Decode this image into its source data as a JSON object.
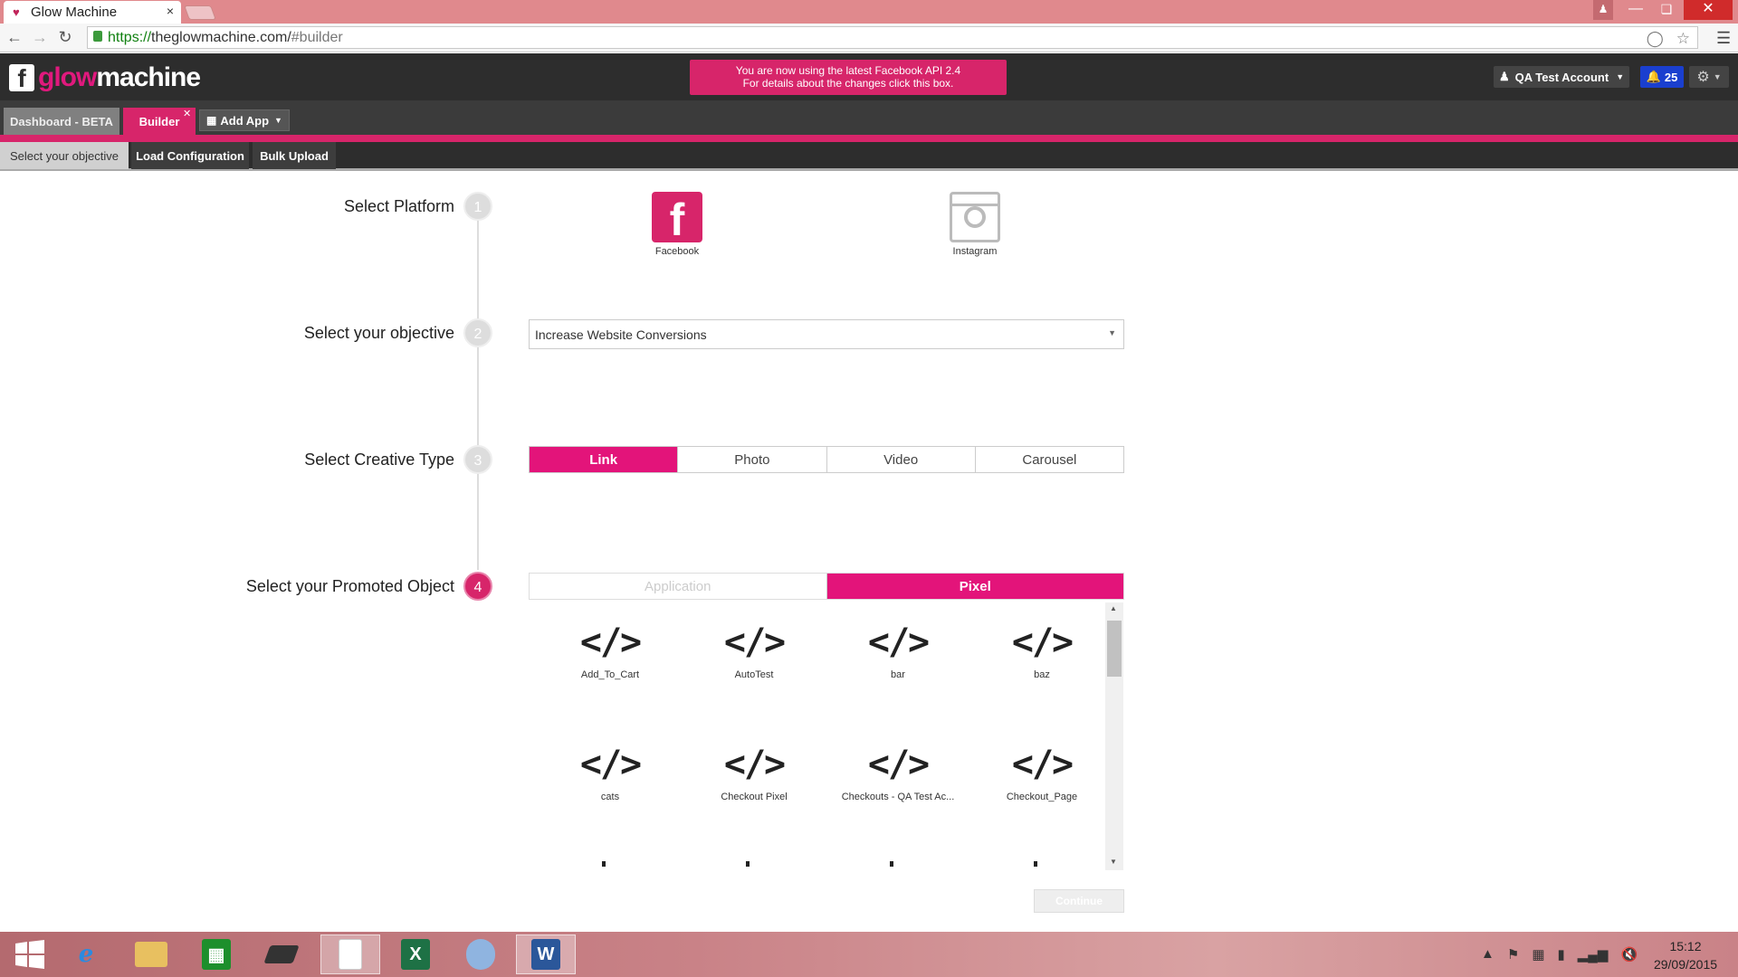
{
  "browser": {
    "tab_title": "Glow Machine",
    "url_scheme": "https://",
    "url_host": "theglowmachine.com/",
    "url_path": "#builder"
  },
  "header": {
    "logo_glow": "glow",
    "logo_machine": "machine",
    "api_notice_line1": "You are now using the latest Facebook API 2.4",
    "api_notice_line2": "For details about the changes click this box.",
    "account_label": "QA Test Account",
    "notification_count": "25"
  },
  "app_tabs": {
    "dashboard": "Dashboard - BETA",
    "builder": "Builder",
    "add_app": "Add App"
  },
  "sub_tabs": {
    "objective": "Select your objective",
    "load": "Load Configuration",
    "bulk": "Bulk Upload"
  },
  "steps": [
    {
      "number": "1",
      "label": "Select Platform"
    },
    {
      "number": "2",
      "label": "Select your objective"
    },
    {
      "number": "3",
      "label": "Select Creative Type"
    },
    {
      "number": "4",
      "label": "Select your Promoted Object"
    }
  ],
  "platforms": {
    "facebook": "Facebook",
    "instagram": "Instagram"
  },
  "objective": {
    "selected": "Increase Website Conversions"
  },
  "creative_types": [
    "Link",
    "Photo",
    "Video",
    "Carousel"
  ],
  "promoted_object_types": [
    "Application",
    "Pixel"
  ],
  "pixels": [
    "Add_To_Cart",
    "AutoTest",
    "bar",
    "baz",
    "cats",
    "Checkout Pixel",
    "Checkouts - QA Test Ac...",
    "Checkout_Page"
  ],
  "pixel_glyph": "</>",
  "continue_label": "Continue",
  "taskbar": {
    "time": "15:12",
    "date": "29/09/2015"
  },
  "colors": {
    "accent": "#e3147a",
    "header_bg": "#2d2d2d",
    "notification": "#1a3fcf"
  }
}
